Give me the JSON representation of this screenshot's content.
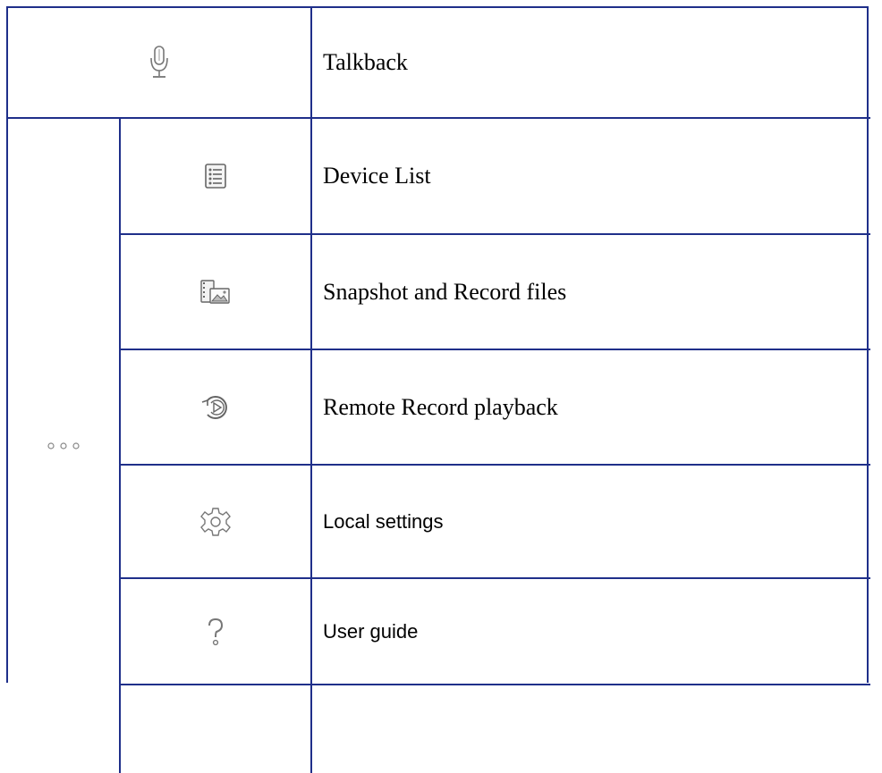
{
  "rows": [
    {
      "icon": "microphone-icon",
      "label": "Talkback"
    },
    {
      "icon": "device-list-icon",
      "label": "Device List"
    },
    {
      "icon": "snapshot-record-files-icon",
      "label": "Snapshot and Record files"
    },
    {
      "icon": "remote-playback-icon",
      "label": "Remote Record playback"
    },
    {
      "icon": "gear-icon",
      "label": "Local settings"
    },
    {
      "icon": "question-mark-icon",
      "label": "User guide"
    }
  ],
  "group_icon": "more-dots-icon"
}
